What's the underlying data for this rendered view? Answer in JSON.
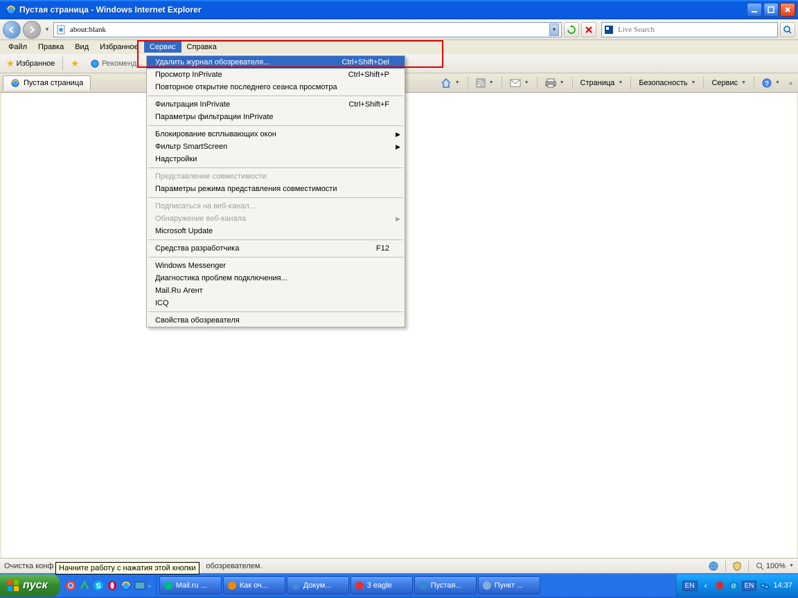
{
  "window_title": "Пустая страница - Windows Internet Explorer",
  "address": "about:blank",
  "search_placeholder": "Live Search",
  "menu": [
    "Файл",
    "Правка",
    "Вид",
    "Избранное",
    "Сервис",
    "Справка"
  ],
  "menu_active_index": 4,
  "favorites_label": "Избранное",
  "recommend_label": "Рекоменд...",
  "tab_title": "Пустая страница",
  "cmdbar": {
    "page": "Страница",
    "safety": "Безопасность",
    "tools": "Сервис"
  },
  "dropdown": [
    {
      "label": "Удалить журнал обозревателя...",
      "shortcut": "Ctrl+Shift+Del",
      "hover": true
    },
    {
      "label": "Просмотр InPrivate",
      "shortcut": "Ctrl+Shift+P"
    },
    {
      "label": "Повторное открытие последнего сеанса просмотра"
    },
    {
      "sep": true
    },
    {
      "label": "Фильтрация InPrivate",
      "shortcut": "Ctrl+Shift+F"
    },
    {
      "label": "Параметры фильтрации InPrivate"
    },
    {
      "sep": true
    },
    {
      "label": "Блокирование всплывающих окон",
      "sub": true
    },
    {
      "label": "Фильтр SmartScreen",
      "sub": true
    },
    {
      "label": "Надстройки"
    },
    {
      "sep": true
    },
    {
      "label": "Представление совместимости",
      "disabled": true
    },
    {
      "label": "Параметры режима представления совместимости"
    },
    {
      "sep": true
    },
    {
      "label": "Подписаться на веб-канал...",
      "disabled": true
    },
    {
      "label": "Обнаружение веб-канала",
      "sub": true,
      "disabled": true
    },
    {
      "label": "Microsoft Update"
    },
    {
      "sep": true
    },
    {
      "label": "Средства разработчика",
      "shortcut": "F12"
    },
    {
      "sep": true
    },
    {
      "label": "Windows Messenger"
    },
    {
      "label": "Диагностика проблем подключения..."
    },
    {
      "label": "Mail.Ru Агент"
    },
    {
      "label": "ICQ"
    },
    {
      "sep": true
    },
    {
      "label": "Свойства обозревателя"
    }
  ],
  "status_left": "Очистка конф",
  "status_right_text": "обозревателем.",
  "tooltip": "Начните работу с нажатия этой кнопки",
  "zoom": "100%",
  "start_label": "пуск",
  "task_items": [
    {
      "label": "Mail.ru ...",
      "color": "#0b8"
    },
    {
      "label": "Как оч...",
      "color": "#e80"
    },
    {
      "label": "Докум...",
      "color": "#48d"
    },
    {
      "label": "3 eagle",
      "color": "#d33"
    },
    {
      "label": "Пустая...",
      "color": "#38c"
    },
    {
      "label": "Пункт ...",
      "color": "#8ad"
    }
  ],
  "lang": "EN",
  "clock": "14:37"
}
